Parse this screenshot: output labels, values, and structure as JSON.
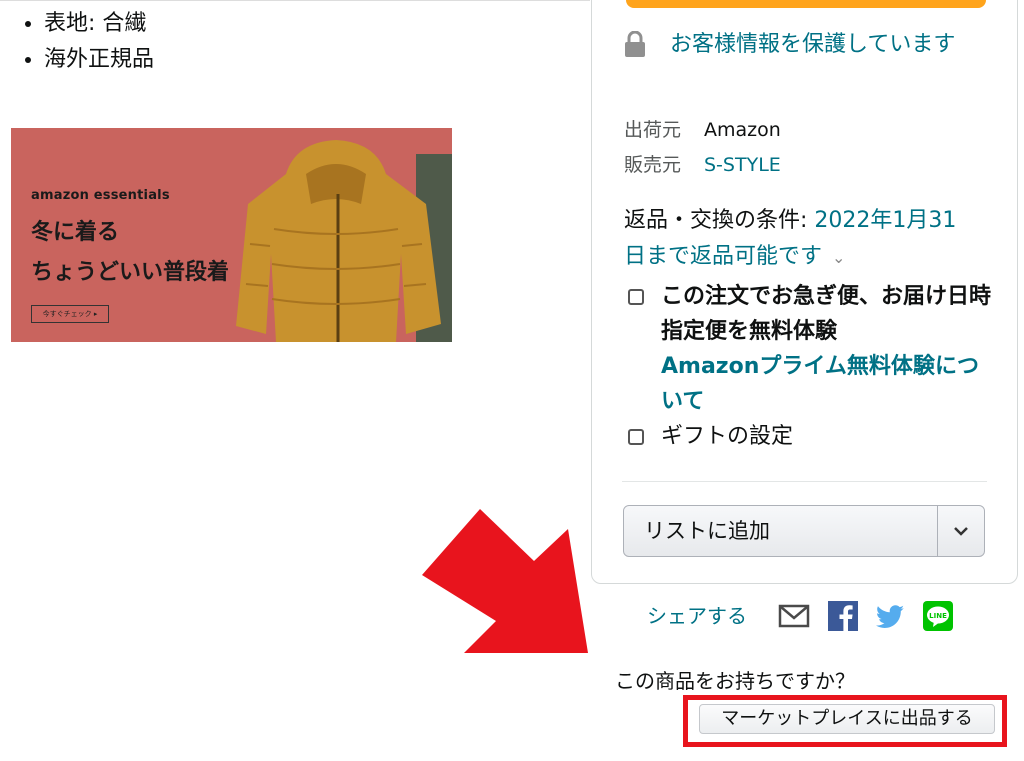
{
  "product": {
    "bullets": [
      "表地: 合繊",
      "海外正規品"
    ]
  },
  "banner": {
    "brand": "amazon essentials",
    "line1": "冬に着る",
    "line2": "ちょうどいい普段着",
    "button": "今すぐチェック ▸"
  },
  "buybox": {
    "secure_text": "お客様情報を保護しています",
    "ship_from_label": "出荷元",
    "ship_from_value": "Amazon",
    "sold_by_label": "販売元",
    "sold_by_value": "S-STYLE",
    "return_label": "返品・交換の条件: ",
    "return_link": "2022年1月31日まで返品可能です",
    "prime_check_text": "この注文でお急ぎ便、お届け日時指定便を無料体験",
    "prime_link": "Amazonプライム無料体験について",
    "gift_text": "ギフトの設定",
    "add_to_list": "リストに追加"
  },
  "share": {
    "label": "シェアする",
    "icons": [
      "mail-icon",
      "facebook-icon",
      "twitter-icon",
      "line-icon"
    ]
  },
  "sell": {
    "question": "この商品をお持ちですか？",
    "button": "マーケットプレイスに出品する"
  },
  "colors": {
    "link": "#007185",
    "annotation_red": "#e8141d",
    "buy_button": "#ffa41c",
    "banner_bg": "#c9645e"
  }
}
